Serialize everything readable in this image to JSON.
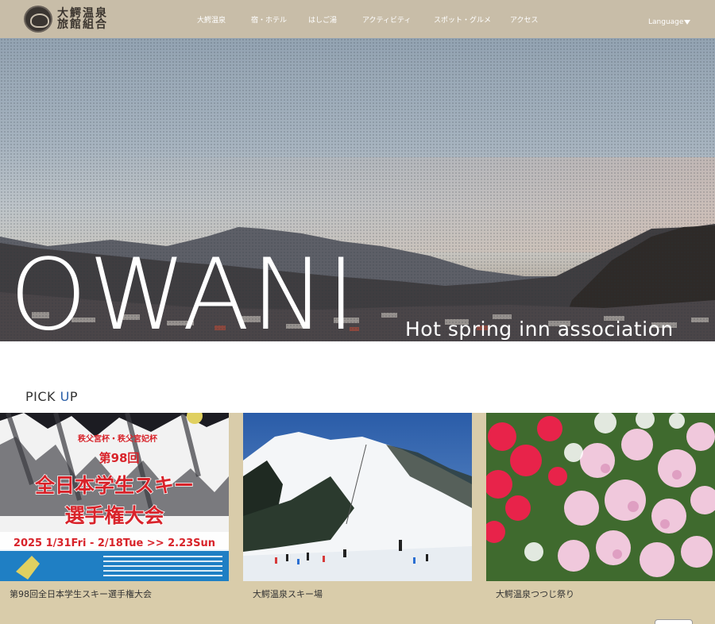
{
  "header": {
    "logo_line1": "大鰐温泉",
    "logo_line2": "旅館組合",
    "nav": [
      "大鰐温泉",
      "宿・ホテル",
      "はしご湯",
      "アクティビティ",
      "スポット・グルメ",
      "アクセス"
    ],
    "language_label": "Language"
  },
  "hero": {
    "title": "OWANI",
    "subtitle": "Hot spring inn association"
  },
  "pickup": {
    "title_part1": "PICK ",
    "title_part2": "U",
    "title_part3": "P",
    "items": [
      {
        "caption": "第98回全日本学生スキー選手権大会",
        "poster_top": "秩父宮杯・秩父宮妃杯",
        "poster_round": "第98回",
        "poster_line1": "全日本学生スキー",
        "poster_line2": "選手権大会",
        "poster_dates": "2025 1/31Fri - 2/18Tue >> 2.23Sun"
      },
      {
        "caption": "大鰐温泉スキー場"
      },
      {
        "caption": "大鰐温泉つつじ祭り"
      }
    ]
  },
  "colors": {
    "header_bg": "#c8bda8",
    "band_bg": "#d9ccaa",
    "accent_blue": "#2a5fa8",
    "poster_red": "#d8232a"
  }
}
